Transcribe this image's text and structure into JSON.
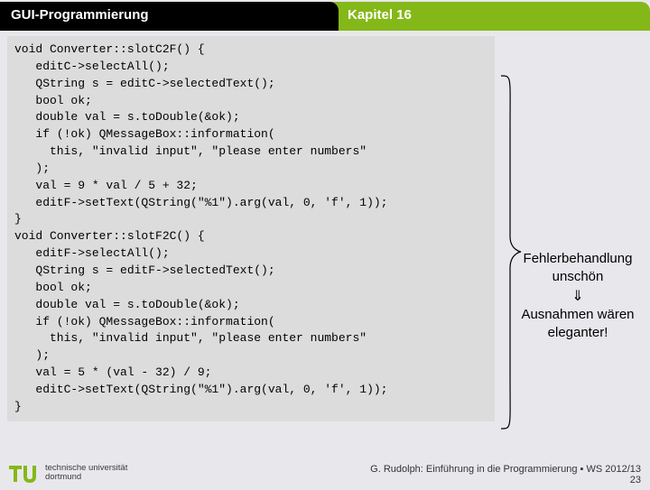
{
  "header": {
    "left": "GUI-Programmierung",
    "right": "Kapitel 16"
  },
  "code": "void Converter::slotC2F() {\n   editC->selectAll();\n   QString s = editC->selectedText();\n   bool ok;\n   double val = s.toDouble(&ok);\n   if (!ok) QMessageBox::information(\n     this, \"invalid input\", \"please enter numbers\"\n   );\n   val = 9 * val / 5 + 32;\n   editF->setText(QString(\"%1\").arg(val, 0, 'f', 1));\n}\nvoid Converter::slotF2C() {\n   editF->selectAll();\n   QString s = editF->selectedText();\n   bool ok;\n   double val = s.toDouble(&ok);\n   if (!ok) QMessageBox::information(\n     this, \"invalid input\", \"please enter numbers\"\n   );\n   val = 5 * (val - 32) / 9;\n   editC->setText(QString(\"%1\").arg(val, 0, 'f', 1));\n}",
  "sideNote": {
    "line1": "Fehlerbehandlung unschön",
    "arrow": "⇓",
    "line2": "Ausnahmen wären eleganter!"
  },
  "footer": {
    "uni1": "technische universität",
    "uni2": "dortmund",
    "credit": "G. Rudolph: Einführung in die Programmierung ▪ WS 2012/13",
    "page": "23"
  }
}
